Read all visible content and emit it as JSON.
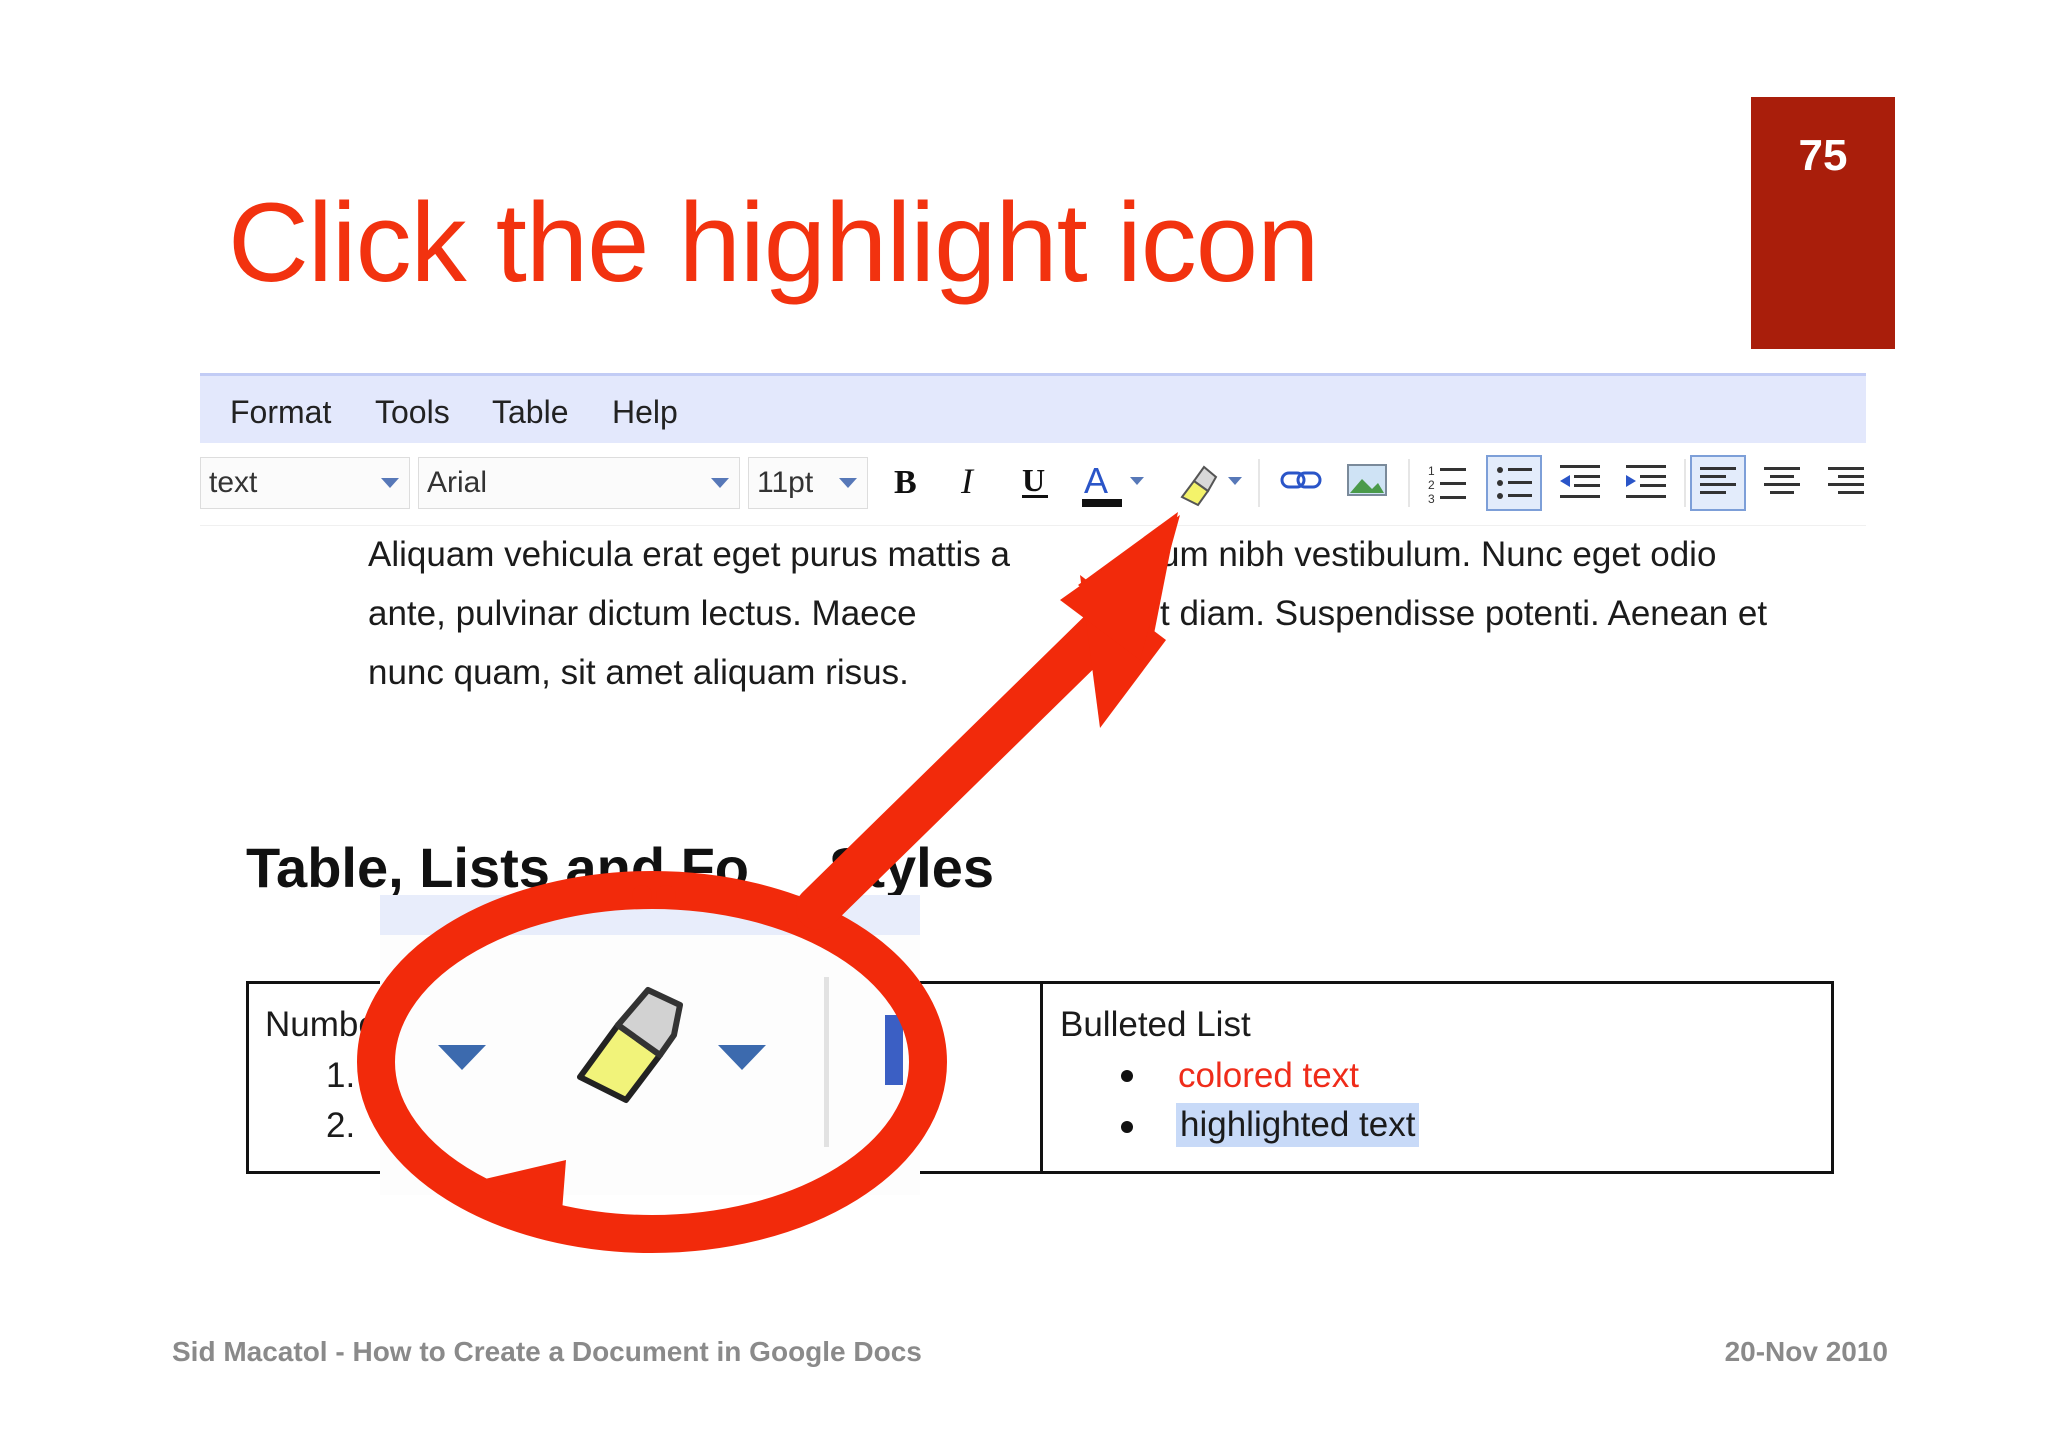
{
  "slide": {
    "page_number": "75",
    "title": "Click the highlight icon",
    "footer_left": "Sid Macatol - How to Create a Document in Google Docs",
    "footer_right": "20-Nov 2010"
  },
  "menu": {
    "items": [
      "Format",
      "Tools",
      "Table",
      "Help"
    ]
  },
  "toolbar": {
    "style_value": "text",
    "font_value": "Arial",
    "size_value": "11pt"
  },
  "document": {
    "para_line1": "Aliquam vehicula erat eget purus mattis a",
    "para_line1_end": "um nibh vestibulum. Nunc eget odio",
    "para_line2": "ante, pulvinar dictum lectus. Maece",
    "para_line2_end": "t diam. Suspendisse potenti. Aenean et",
    "para_line3": "nunc quam, sit amet aliquam risus.",
    "heading_left": "Table, Lists and Fo",
    "heading_right": "Styles",
    "numbered_header": "Numbe",
    "numbered_items": [
      "1.",
      "2."
    ],
    "bulleted_header": "Bulleted List",
    "bullet_colored": "colored text",
    "bullet_highlighted": "highlighted text"
  },
  "colors": {
    "accent_red": "#f2320f",
    "badge_red": "#a91e0b",
    "highlight_blue": "#c8daf8",
    "menu_bg": "#e3e8fc"
  }
}
